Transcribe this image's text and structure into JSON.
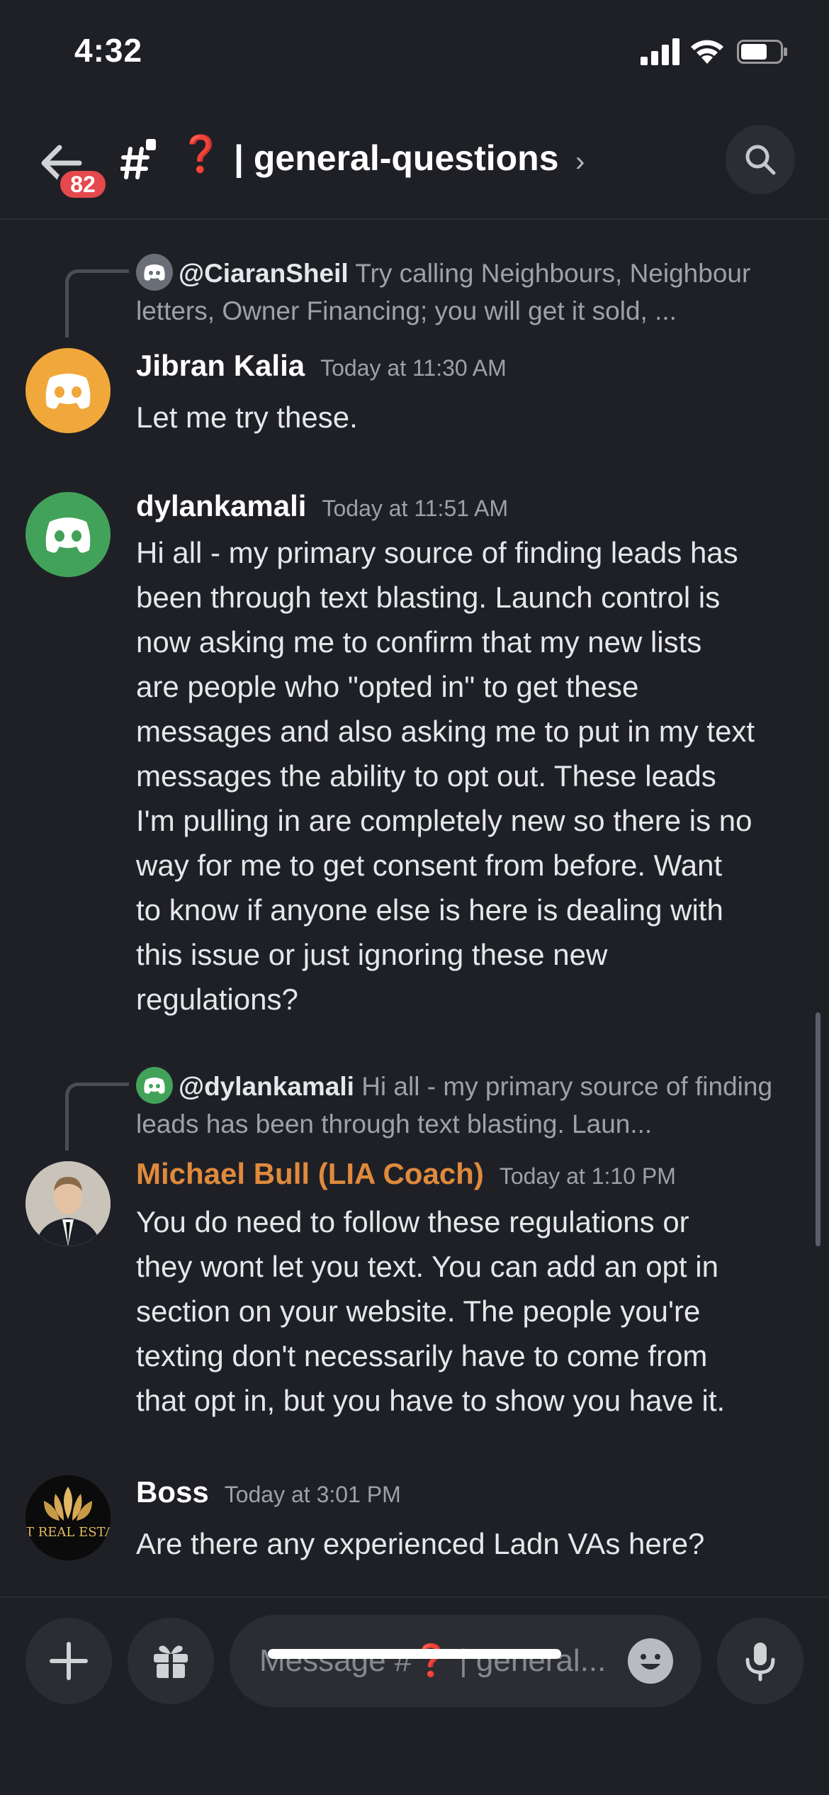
{
  "status_bar": {
    "time": "4:32"
  },
  "header": {
    "unread_badge": "82",
    "channel_emoji": "❓",
    "channel_name": "| general-questions",
    "chevron": "›",
    "icons": [
      "back-arrow-icon",
      "hash-thread-icon",
      "search-icon"
    ]
  },
  "messages": [
    {
      "reply": {
        "mention": "@CiaranSheil",
        "preview": "Try calling Neighbours, Neighbour letters, Owner Financing; you will get it sold, ..."
      },
      "author": "Jibran Kalia",
      "author_color": "#ffffff",
      "avatar_color": "#f0a83a",
      "timestamp": "Today at 11:30 AM",
      "text": "Let me try these."
    },
    {
      "author": "dylankamali",
      "author_color": "#ffffff",
      "avatar_color": "#43a25a",
      "timestamp": "Today at 11:51 AM",
      "text": "Hi all - my primary source of finding leads has\nbeen through text blasting. Launch control is\nnow asking me to confirm that my new lists\nare  people who \"opted in\" to get these\nmessages and also asking me to put in my text\nmessages the ability to opt out. These leads\nI'm pulling in are completely new so there is no\nway for me to get consent from before. Want\nto know if anyone else is here is dealing with\nthis issue or just ignoring these new\nregulations?"
    },
    {
      "reply": {
        "mention": "@dylankamali",
        "preview": "Hi all - my primary source of finding leads has been through text blasting. Laun..."
      },
      "author": "Michael Bull (LIA Coach)",
      "author_color": "#e08a3c",
      "timestamp": "Today at 1:10 PM",
      "text": "You do need to follow these regulations or\nthey wont let you text. You can add an opt in\nsection on your website. The people you're\ntexting don't necessarily have to come from\nthat opt in, but you have to show you have it."
    },
    {
      "author": "Boss",
      "author_color": "#ffffff",
      "avatar_text": "T REAL ESTA",
      "timestamp": "Today at 3:01 PM",
      "text": "Are there any experienced Ladn VAs here?"
    }
  ],
  "composer": {
    "placeholder_prefix": "Message #",
    "placeholder_emoji": "❓",
    "placeholder_suffix": " | general...",
    "icons": [
      "plus-icon",
      "gift-icon",
      "emoji-icon",
      "microphone-icon"
    ]
  }
}
